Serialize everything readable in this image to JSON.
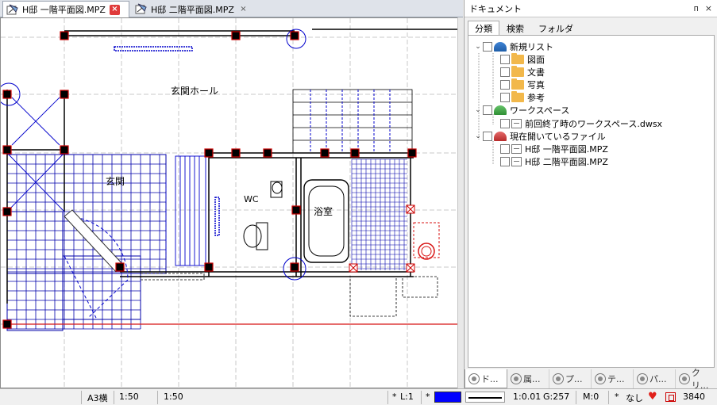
{
  "tabs": [
    {
      "label": "H邸 一階平面図.MPZ",
      "active": true
    },
    {
      "label": "H邸 二階平面図.MPZ",
      "active": false
    }
  ],
  "drawing": {
    "labels": [
      "玄関ホール",
      "玄関",
      "WC",
      "浴室"
    ],
    "colors": {
      "line": "#0000cc",
      "grid": "#000080",
      "column": "#cc0000",
      "ref": "#d81515",
      "gridline": "#bfbfbf"
    }
  },
  "panel": {
    "title": "ドキュメント",
    "buttons": [
      "ᴨ",
      "×"
    ],
    "tabs": [
      "分類",
      "検索",
      "フォルダ"
    ],
    "tree": [
      {
        "label": "新規リスト",
        "level": 0,
        "icon": "blue-dome-icon",
        "expanded": true
      },
      {
        "label": "図面",
        "level": 1,
        "icon": "folder-icon"
      },
      {
        "label": "文書",
        "level": 1,
        "icon": "folder-icon"
      },
      {
        "label": "写真",
        "level": 1,
        "icon": "folder-icon"
      },
      {
        "label": "参考",
        "level": 1,
        "icon": "folder-icon"
      },
      {
        "label": "ワークスペース",
        "level": 0,
        "icon": "green-dome-icon",
        "expanded": true
      },
      {
        "label": "前回終了時のワークスペース.dwsx",
        "level": 1,
        "icon": "file-icon"
      },
      {
        "label": "現在開いているファイル",
        "level": 0,
        "icon": "red-dome-icon",
        "expanded": true
      },
      {
        "label": "H邸 一階平面図.MPZ",
        "level": 1,
        "icon": "file-icon"
      },
      {
        "label": "H邸 二階平面図.MPZ",
        "level": 1,
        "icon": "file-icon"
      }
    ],
    "bottom_tabs": [
      "ド...",
      "属...",
      "プ...",
      "テ...",
      "パ...",
      "クリ..."
    ]
  },
  "status": {
    "paper": "A3横",
    "scale1": "1:50",
    "scale2": "1:50",
    "star1": "*",
    "layer": "L:1",
    "star2": "*",
    "line_scale": "1:0.01",
    "group": "G:257",
    "mode": "M:0",
    "star3": "*",
    "none": "なし",
    "count": "3840",
    "line_color": "#0000ff"
  }
}
